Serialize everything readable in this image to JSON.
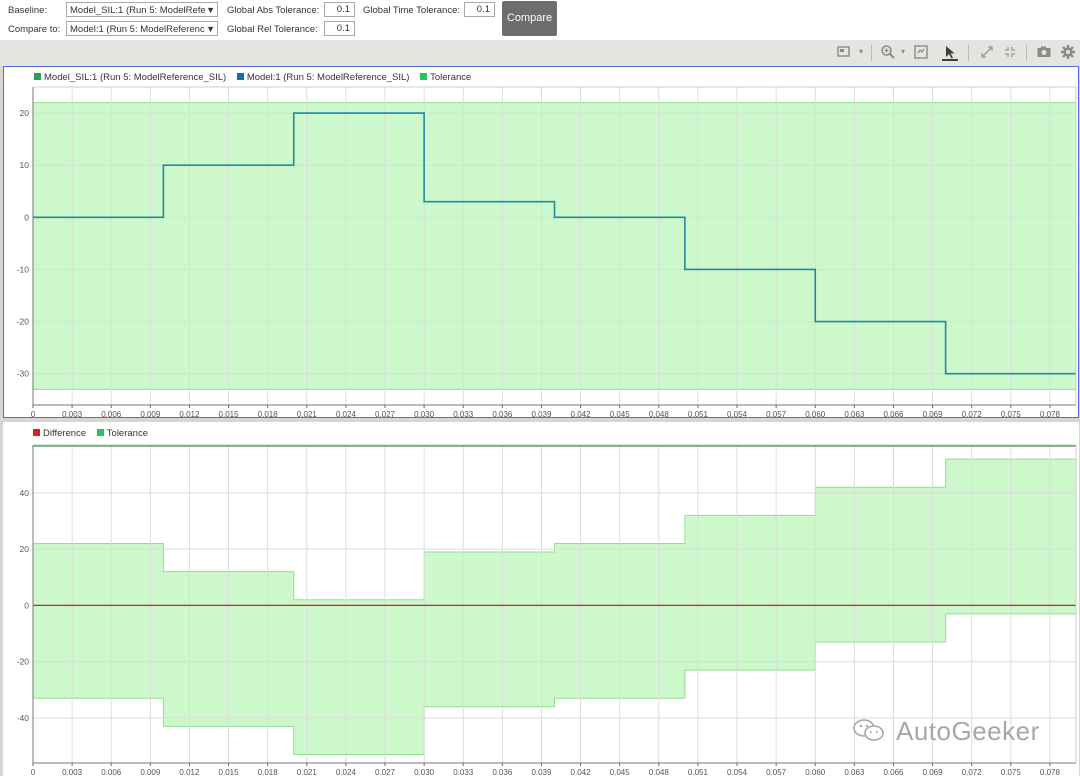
{
  "toolbar": {
    "baseline_label": "Baseline:",
    "baseline_value": "Model_SIL:1 (Run 5: ModelRefe",
    "compare_to_label": "Compare to:",
    "compare_to_value": "Model:1 (Run 5: ModelReferenc",
    "abs_tol_label": "Global Abs Tolerance:",
    "abs_tol_value": "0.1",
    "rel_tol_label": "Global Rel Tolerance:",
    "rel_tol_value": "0.1",
    "time_tol_label": "Global Time Tolerance:",
    "time_tol_value": "0.1",
    "compare_label": "Compare"
  },
  "plot_toolbar_icons": [
    "layout-icon",
    "zoom-icon",
    "fit-icon",
    "cursor-icon",
    "expand-icon",
    "compress-icon",
    "camera-icon",
    "gear-icon"
  ],
  "watermark": "AutoGeeker",
  "colors": {
    "baseline": "#2e9e5b",
    "compare": "#0a6fb4",
    "signal_line": "#1f8aa0",
    "tolerance_fill": "#ccf8cc",
    "tolerance_edge": "#8fe08f",
    "difference": "#d92020",
    "grid": "#dcdcdc"
  },
  "chart_data": [
    {
      "type": "line",
      "legend": [
        {
          "name": "Model_SIL:1 (Run 5: ModelReference_SIL)",
          "color": "#2e9e5b"
        },
        {
          "name": "Model:1 (Run 5: ModelReference_SIL)",
          "color": "#0a6fb4"
        },
        {
          "name": "Tolerance",
          "color": "#22c55e"
        }
      ],
      "xlim": [
        0,
        0.08
      ],
      "ylim": [
        -36,
        25
      ],
      "xticks": [
        "0",
        "0.003",
        "0.006",
        "0.009",
        "0.012",
        "0.015",
        "0.018",
        "0.021",
        "0.024",
        "0.027",
        "0.030",
        "0.033",
        "0.036",
        "0.039",
        "0.042",
        "0.045",
        "0.048",
        "0.051",
        "0.054",
        "0.057",
        "0.060",
        "0.063",
        "0.066",
        "0.069",
        "0.072",
        "0.075",
        "0.078"
      ],
      "yticks": [
        20,
        10,
        0,
        -10,
        -20,
        -30
      ],
      "series": [
        {
          "x": [
            0,
            0.01,
            0.01,
            0.02,
            0.02,
            0.03,
            0.03,
            0.04,
            0.04,
            0.05,
            0.05,
            0.06,
            0.06,
            0.07,
            0.07,
            0.08
          ],
          "y": [
            0,
            0,
            10,
            10,
            20,
            20,
            3,
            3,
            0,
            0,
            -10,
            -10,
            -20,
            -20,
            -30,
            -30
          ]
        }
      ],
      "tolerance_band": {
        "x": [
          0,
          0.08
        ],
        "upper": [
          22,
          22
        ],
        "lower": [
          -33,
          -33
        ]
      }
    },
    {
      "type": "line",
      "legend": [
        {
          "name": "Difference",
          "color": "#d92020"
        },
        {
          "name": "Tolerance",
          "color": "#22c55e"
        }
      ],
      "xlim": [
        0,
        0.08
      ],
      "ylim": [
        -56,
        57
      ],
      "xticks": [
        "0",
        "0.003",
        "0.006",
        "0.009",
        "0.012",
        "0.015",
        "0.018",
        "0.021",
        "0.024",
        "0.027",
        "0.030",
        "0.033",
        "0.036",
        "0.039",
        "0.042",
        "0.045",
        "0.048",
        "0.051",
        "0.054",
        "0.057",
        "0.060",
        "0.063",
        "0.066",
        "0.069",
        "0.072",
        "0.075",
        "0.078"
      ],
      "yticks": [
        40,
        20,
        0,
        -20,
        -40
      ],
      "difference": {
        "x": [
          0,
          0.08
        ],
        "y": [
          0,
          0
        ]
      },
      "tolerance_steps": [
        {
          "x0": 0,
          "x1": 0.01,
          "upper": 22,
          "lower": -33
        },
        {
          "x0": 0.01,
          "x1": 0.02,
          "upper": 12,
          "lower": -43
        },
        {
          "x0": 0.02,
          "x1": 0.03,
          "upper": 2,
          "lower": -53
        },
        {
          "x0": 0.03,
          "x1": 0.04,
          "upper": 19,
          "lower": -36
        },
        {
          "x0": 0.04,
          "x1": 0.05,
          "upper": 22,
          "lower": -33
        },
        {
          "x0": 0.05,
          "x1": 0.06,
          "upper": 32,
          "lower": -23
        },
        {
          "x0": 0.06,
          "x1": 0.07,
          "upper": 42,
          "lower": -13
        },
        {
          "x0": 0.07,
          "x1": 0.08,
          "upper": 52,
          "lower": -3
        }
      ]
    }
  ]
}
